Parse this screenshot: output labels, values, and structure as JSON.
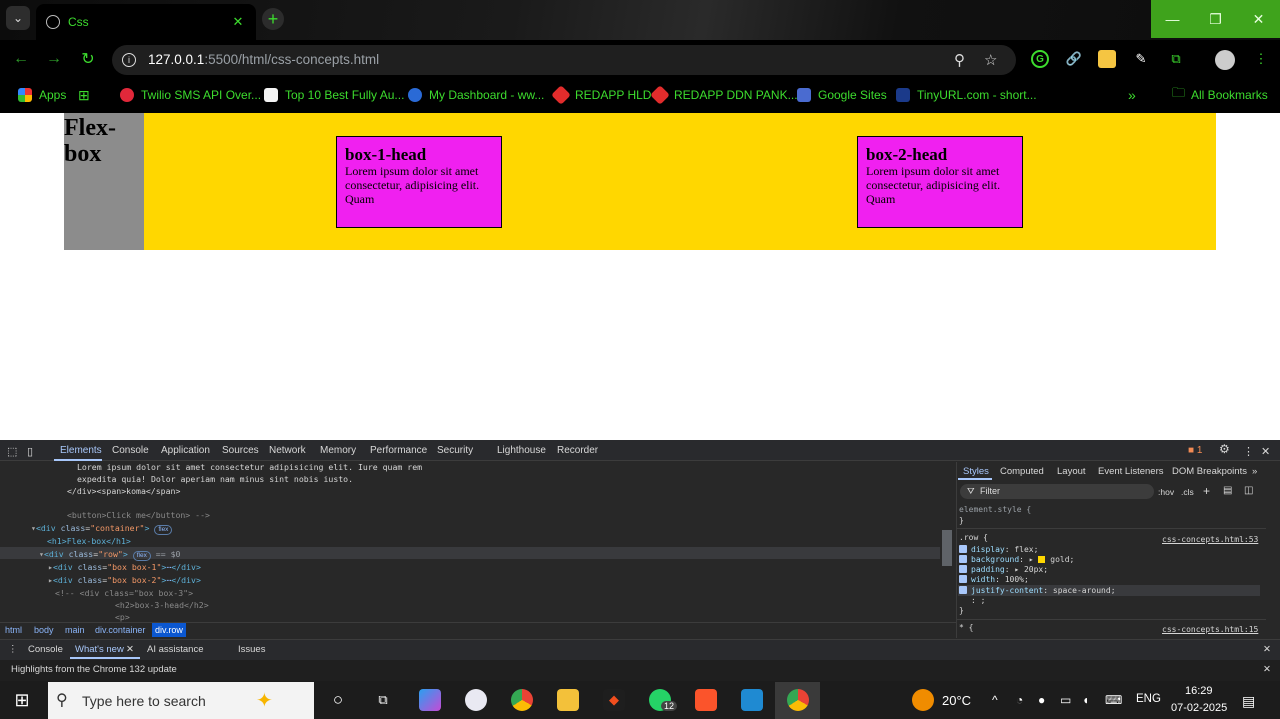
{
  "browser": {
    "tab_title": "Css",
    "url_host": "127.0.0.1",
    "url_rest": ":5500/html/css-concepts.html",
    "bookmarks": [
      {
        "label": "Apps",
        "color": "#e0453a"
      },
      {
        "label": "Twilio SMS API Over...",
        "color": "#e1283a"
      },
      {
        "label": "Top 10 Best Fully Au...",
        "color": "#f4f4f4"
      },
      {
        "label": "My Dashboard - ww...",
        "color": "#2a6ad6"
      },
      {
        "label": "REDAPP HLD",
        "color": "#e22c2c"
      },
      {
        "label": "REDAPP DDN PANK...",
        "color": "#e22c2c"
      },
      {
        "label": "Google Sites",
        "color": "#4a6bd0"
      },
      {
        "label": "TinyURL.com - short...",
        "color": "#1b3a8a"
      }
    ],
    "all_bookmarks": "All Bookmarks"
  },
  "page": {
    "heading": "Flex-box",
    "boxes": [
      {
        "head": "box-1-head",
        "text": "Lorem ipsum dolor sit amet consectetur, adipisicing elit. Quam"
      },
      {
        "head": "box-2-head",
        "text": "Lorem ipsum dolor sit amet consectetur, adipisicing elit. Quam"
      }
    ]
  },
  "devtools": {
    "tabs": [
      "Elements",
      "Console",
      "Application",
      "Sources",
      "Network",
      "Memory",
      "Performance",
      "Security",
      "Lighthouse",
      "Recorder"
    ],
    "issues_count": "1",
    "breadcrumbs": [
      "html",
      "body",
      "main",
      "div.container",
      "div.row"
    ],
    "styles_tabs": [
      "Styles",
      "Computed",
      "Layout",
      "Event Listeners",
      "DOM Breakpoints"
    ],
    "filter_placeholder": "Filter",
    "hov": ":hov",
    "cls": ".cls",
    "element_style": "element.style {",
    "rule_selector": ".row {",
    "rule_source": "css-concepts.html:53",
    "rule2_selector": "* {",
    "rule2_source": "css-concepts.html:15",
    "props": [
      {
        "name": "display",
        "value": "flex;"
      },
      {
        "name": "background",
        "value": "gold;"
      },
      {
        "name": "padding",
        "value": "20px;"
      },
      {
        "name": "width",
        "value": "100%;"
      },
      {
        "name": "justify-content",
        "value": "space-around;"
      }
    ],
    "drawer_tabs": [
      "Console",
      "What's new",
      "AI assistance",
      "Issues"
    ],
    "highlights": "Highlights from the Chrome 132 update",
    "code_lines": {
      "l1": "Lorem ipsum dolor sit amet consectetur adipisicing elit. Iure quam rem",
      "l2": "expedita quia! Dolor aperiam nam minus sint nobis iusto.",
      "l3": "</div><span>koma</span>",
      "l4": "<button>Click me</button> -->",
      "l5_tag": "div",
      "l5_attr": "class",
      "l5_val": "\"container\"",
      "l6": "<h1>Flex-box</h1>",
      "l7_val": "\"row\"",
      "l7_suffix": "== $0",
      "l8_val": "\"box box-1\"",
      "l9_val": "\"box box-2\"",
      "l10": "<!-- <div class=\"box box-3\">",
      "l11": "<h2>box-3-head</h2>",
      "l12": "<p>",
      "flex_badge": "flex"
    }
  },
  "taskbar": {
    "search_placeholder": "Type here to search",
    "whatsapp_badge": "12",
    "temperature": "20°C",
    "lang": "ENG",
    "time": "16:29",
    "date": "07-02-2025"
  }
}
